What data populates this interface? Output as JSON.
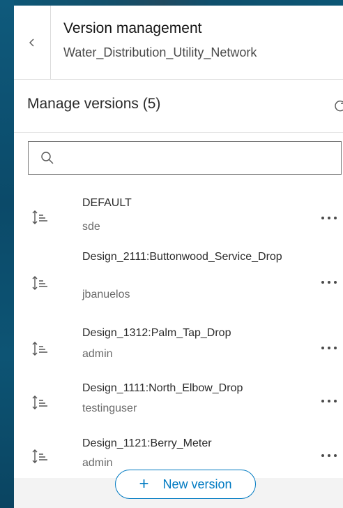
{
  "header": {
    "title": "Version management",
    "subtitle": "Water_Distribution_Utility_Network"
  },
  "manage": {
    "label": "Manage versions (5)"
  },
  "search": {
    "value": "",
    "placeholder": ""
  },
  "versions": [
    {
      "name": "DEFAULT",
      "owner": "sde"
    },
    {
      "name": "Design_2111:Buttonwood_Service_Drop",
      "owner": "jbanuelos"
    },
    {
      "name": "Design_1312:Palm_Tap_Drop",
      "owner": "admin"
    },
    {
      "name": "Design_1111:North_Elbow_Drop",
      "owner": "testinguser"
    },
    {
      "name": "Design_1121:Berry_Meter",
      "owner": "admin"
    }
  ],
  "footer": {
    "new_version_label": "New version"
  },
  "colors": {
    "accent": "#007ac2",
    "map_background": "#0d4e6e"
  }
}
